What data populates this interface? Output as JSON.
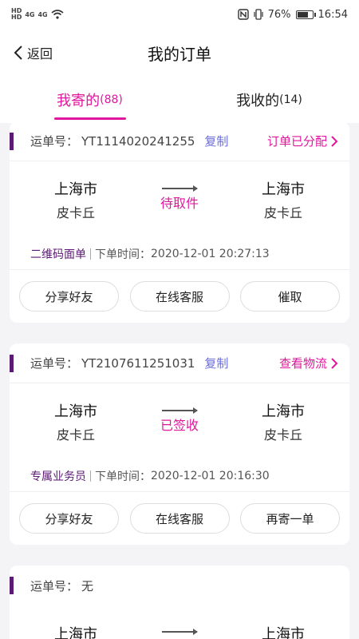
{
  "status_bar": {
    "left_badges": [
      "HD",
      "4G",
      "HD",
      "4G"
    ],
    "battery": "76%",
    "battery_level": 0.76,
    "time": "16:54"
  },
  "nav": {
    "back_label": "返回",
    "title": "我的订单"
  },
  "tabs": [
    {
      "label": "我寄的",
      "count": "(88)",
      "active": true
    },
    {
      "label": "我收的",
      "count": "(14)",
      "active": false
    }
  ],
  "common": {
    "waybill_label": "运单号：",
    "copy_label": "复制",
    "from_city": "上海市",
    "from_name": "皮卡丘",
    "to_city": "上海市",
    "to_name": "皮卡丘",
    "order_time_label": "下单时间："
  },
  "orders": [
    {
      "waybill_no": "YT1114020241255",
      "status_link": "订单已分配",
      "state": "待取件",
      "tag": "二维码面单",
      "order_time": "2020-12-01 20:27:13",
      "actions": [
        "分享好友",
        "在线客服",
        "催取"
      ]
    },
    {
      "waybill_no": "YT2107611251031",
      "status_link": "查看物流",
      "state": "已签收",
      "tag": "专属业务员",
      "order_time": "2020-12-01 20:16:30",
      "actions": [
        "分享好友",
        "在线客服",
        "再寄一单"
      ]
    },
    {
      "waybill_no": "无"
    }
  ],
  "colors": {
    "accent": "#e0179d",
    "marker": "#5b1a73",
    "copy": "#6a6ed8"
  }
}
